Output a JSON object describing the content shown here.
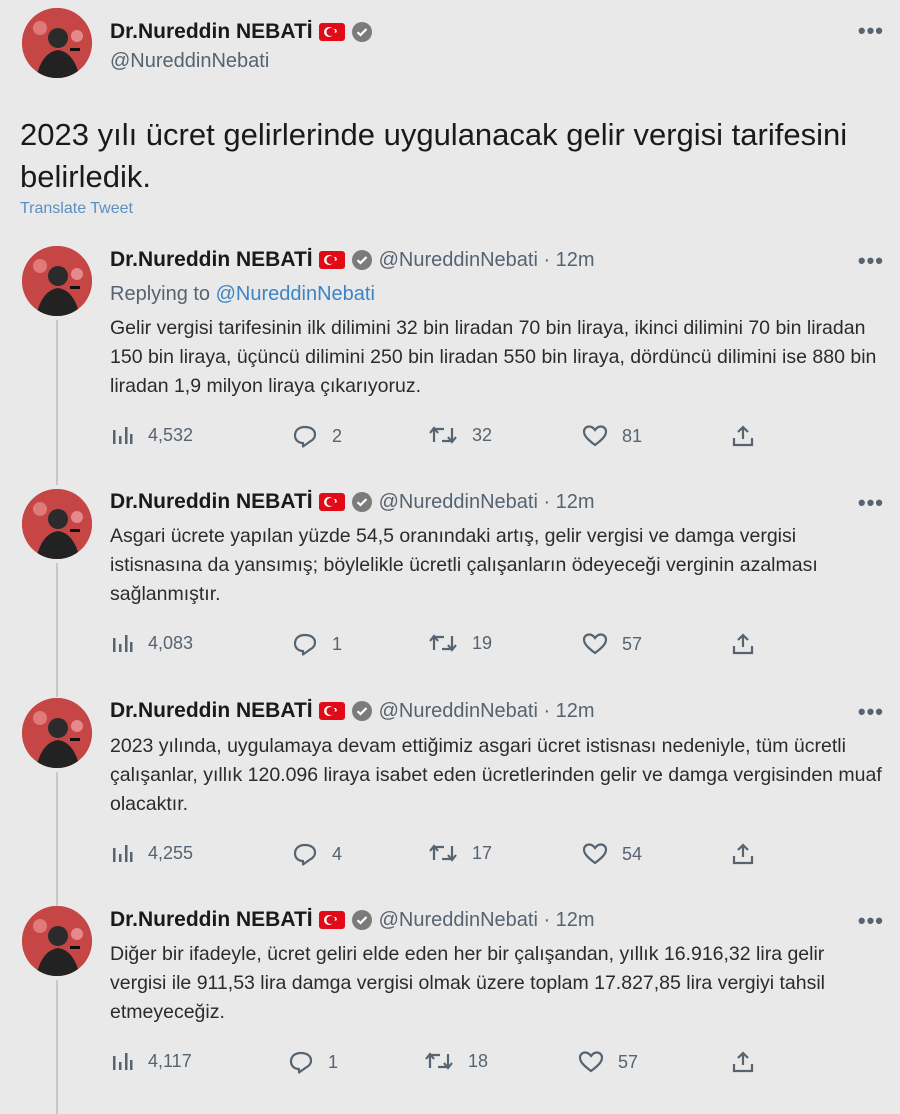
{
  "author": {
    "name": "Dr.Nureddin NEBATİ",
    "handle": "@NureddinNebati"
  },
  "main_tweet": {
    "text": "2023 yılı ücret gelirlerinde uygulanacak gelir vergisi tarifesini belirledik.",
    "translate_label": "Translate Tweet"
  },
  "replies": [
    {
      "meta": "@NureddinNebati · 12m",
      "replying_prefix": "Replying to ",
      "replying_handle": "@NureddinNebati",
      "text": "Gelir vergisi tarifesinin ilk dilimini 32 bin liradan 70 bin liraya, ikinci dilimini 70 bin liradan 150 bin liraya, üçüncü dilimini 250 bin liradan 550 bin liraya, dördüncü dilimini ise 880 bin liradan 1,9 milyon liraya çıkarıyoruz.",
      "views": "4,532",
      "replies": "2",
      "retweets": "32",
      "likes": "81"
    },
    {
      "meta": "@NureddinNebati · 12m",
      "text": "Asgari ücrete yapılan yüzde 54,5 oranındaki artış, gelir vergisi ve damga vergisi istisnasına da yansımış; böylelikle ücretli çalışanların ödeyeceği verginin azalması sağlanmıştır.",
      "views": "4,083",
      "replies": "1",
      "retweets": "19",
      "likes": "57"
    },
    {
      "meta": "@NureddinNebati · 12m",
      "text": "2023 yılında, uygulamaya devam ettiğimiz asgari ücret istisnası nedeniyle, tüm ücretli çalışanlar, yıllık 120.096 liraya isabet eden ücretlerinden gelir ve damga vergisinden muaf olacaktır.",
      "views": "4,255",
      "replies": "4",
      "retweets": "17",
      "likes": "54"
    },
    {
      "meta": "@NureddinNebati · 12m",
      "text": "Diğer bir ifadeyle, ücret geliri elde eden her bir çalışandan, yıllık 16.916,32 lira gelir vergisi ile 911,53 lira damga vergisi olmak üzere toplam 17.827,85 lira vergiyi tahsil etmeyeceğiz.",
      "views": "4,117",
      "replies": "1",
      "retweets": "18",
      "likes": "57"
    }
  ],
  "colors": {
    "background": "#e9e9e9",
    "link": "#3d84c6",
    "muted": "#566370",
    "flag_red": "#e30a17"
  },
  "icons": [
    "more-icon",
    "verified-icon",
    "flag-icon",
    "views-icon",
    "reply-icon",
    "retweet-icon",
    "like-icon",
    "share-icon"
  ]
}
